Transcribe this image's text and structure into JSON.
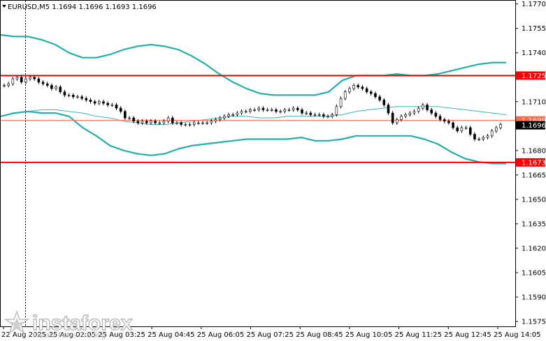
{
  "header": {
    "title": "EURUSD,M5  1.1694 1.1696 1.1693 1.1696"
  },
  "logo": {
    "brand": "instaforex",
    "tagline": "Instant Forex Trading"
  },
  "colors": {
    "background": "#ffffff",
    "candle": "#000000",
    "band": "#20b2aa",
    "middle_band": "#20b2aa",
    "level_line": "#ff0000",
    "level_label_bg": "#ff0000",
    "price_label_bg": "#000000",
    "grid_dash": "#000000"
  },
  "chart_data": {
    "type": "candlestick",
    "symbol": "EURUSD",
    "timeframe": "M5",
    "ylim": [
      1.1572,
      1.1772
    ],
    "y_ticks": [
      "1.1770",
      "1.1755",
      "1.1740",
      "1.1725",
      "1.1710",
      "1.1695",
      "1.1680",
      "1.1665",
      "1.1650",
      "1.1635",
      "1.1620",
      "1.1605",
      "1.1590",
      "1.1575"
    ],
    "x_ticks": [
      "22 Aug 2025",
      "25 Aug 02:05",
      "25 Aug 03:25",
      "25 Aug 04:45",
      "25 Aug 06:05",
      "25 Aug 07:25",
      "25 Aug 08:45",
      "25 Aug 10:05",
      "25 Aug 11:25",
      "25 Aug 12:45",
      "25 Aug 14:05"
    ],
    "levels": [
      {
        "label": "1.1725",
        "value": 1.1726
      },
      {
        "label": "1.1699",
        "value": 1.16985
      },
      {
        "label": "1.1673",
        "value": 1.16727
      }
    ],
    "current_price": {
      "label": "1.1696",
      "value": 1.16955
    },
    "closes": [
      1.172,
      1.1721,
      1.1724,
      1.1725,
      1.1722,
      1.1724,
      1.1725,
      1.1724,
      1.1722,
      1.1721,
      1.172,
      1.1718,
      1.1719,
      1.1716,
      1.1714,
      1.1714,
      1.1713,
      1.1713,
      1.1712,
      1.1711,
      1.171,
      1.1709,
      1.171,
      1.1709,
      1.1708,
      1.1708,
      1.1706,
      1.1704,
      1.17,
      1.17,
      1.1698,
      1.1697,
      1.1698,
      1.1697,
      1.1698,
      1.1697,
      1.1697,
      1.1698,
      1.17,
      1.1697,
      1.1697,
      1.1696,
      1.1696,
      1.1696,
      1.1697,
      1.1697,
      1.1697,
      1.1697,
      1.1698,
      1.1699,
      1.17,
      1.1701,
      1.1702,
      1.1702,
      1.1703,
      1.1704,
      1.1704,
      1.1705,
      1.1705,
      1.1706,
      1.1705,
      1.1705,
      1.1705,
      1.1704,
      1.1704,
      1.1705,
      1.1705,
      1.1706,
      1.1705,
      1.1703,
      1.1703,
      1.1702,
      1.1702,
      1.1702,
      1.1701,
      1.1701,
      1.1702,
      1.1707,
      1.1712,
      1.1716,
      1.1718,
      1.172,
      1.1719,
      1.1718,
      1.1716,
      1.1715,
      1.1713,
      1.1711,
      1.1708,
      1.1703,
      1.1697,
      1.1699,
      1.1701,
      1.1702,
      1.1703,
      1.1704,
      1.1706,
      1.1708,
      1.1705,
      1.1703,
      1.1701,
      1.1699,
      1.1698,
      1.1697,
      1.1694,
      1.1692,
      1.1694,
      1.1694,
      1.169,
      1.1687,
      1.1687,
      1.1688,
      1.1689,
      1.1692,
      1.1694,
      1.1696
    ],
    "bollinger_upper": [
      1.1751,
      1.175,
      1.175,
      1.1748,
      1.1745,
      1.174,
      1.1737,
      1.1737,
      1.1739,
      1.1742,
      1.1744,
      1.1745,
      1.1744,
      1.1742,
      1.1738,
      1.1733,
      1.1727,
      1.1722,
      1.1718,
      1.1715,
      1.1714,
      1.1714,
      1.1714,
      1.1714,
      1.1716,
      1.1723,
      1.1726,
      1.1726,
      1.1726,
      1.1727,
      1.1726,
      1.1726,
      1.1727,
      1.1729,
      1.1731,
      1.1733,
      1.1734,
      1.1734
    ],
    "bollinger_middle": [
      1.1701,
      1.1703,
      1.1704,
      1.1705,
      1.1705,
      1.1704,
      1.1703,
      1.1701,
      1.17,
      1.1698,
      1.1697,
      1.1696,
      1.1696,
      1.1697,
      1.1698,
      1.1699,
      1.17,
      1.1701,
      1.1701,
      1.17,
      1.17,
      1.1701,
      1.1701,
      1.1701,
      1.1701,
      1.1702,
      1.1704,
      1.1705,
      1.1706,
      1.1707,
      1.1707,
      1.1707,
      1.1707,
      1.1706,
      1.1705,
      1.1704,
      1.1703,
      1.1702
    ],
    "bollinger_lower": [
      1.1701,
      1.1703,
      1.1704,
      1.1703,
      1.1703,
      1.1701,
      1.1694,
      1.1689,
      1.1683,
      1.168,
      1.1678,
      1.1677,
      1.1678,
      1.1681,
      1.1683,
      1.1684,
      1.1685,
      1.1686,
      1.1687,
      1.1687,
      1.1687,
      1.1687,
      1.1688,
      1.1686,
      1.1686,
      1.1687,
      1.1689,
      1.1689,
      1.1689,
      1.1689,
      1.1689,
      1.1687,
      1.1684,
      1.1679,
      1.1675,
      1.1673,
      1.1672,
      1.1672
    ]
  }
}
